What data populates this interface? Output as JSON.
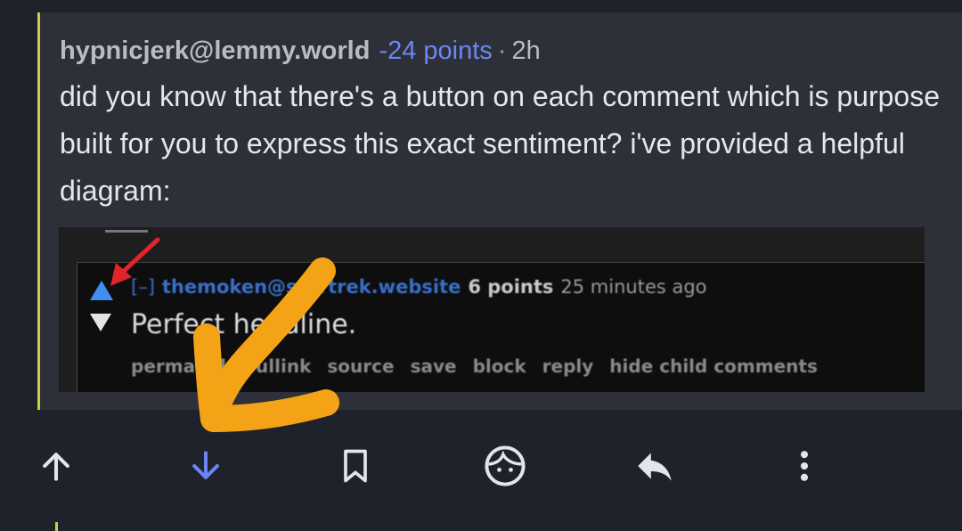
{
  "comment": {
    "author": "hypnicjerk@lemmy.world",
    "score": "-24 points",
    "separator": "·",
    "time": "2h",
    "body": "did you know that there's a button on each comment which is purpose built for you to express this exact sentiment? i've provided a helpful diagram:"
  },
  "embedded_screenshot": {
    "collapse": "[–]",
    "username": "themoken@startrek.website",
    "points": "6 points",
    "age": "25 minutes ago",
    "text": "Perfect headline.",
    "links": [
      "permalink",
      "fullink",
      "source",
      "save",
      "block",
      "reply",
      "hide child comments"
    ]
  },
  "actions": {
    "upvote": "upvote-icon",
    "downvote": "downvote-icon",
    "save": "bookmark-icon",
    "profile": "face-icon",
    "reply": "reply-icon",
    "more": "more-vertical-icon"
  },
  "colors": {
    "background": "#20222b",
    "card": "#2e3039",
    "score": "#6b86f2",
    "downvote_active": "#6b86f2",
    "thread_line": "#c9cf3f",
    "annotation_orange": "#f5a316",
    "annotation_red": "#e0242b"
  }
}
